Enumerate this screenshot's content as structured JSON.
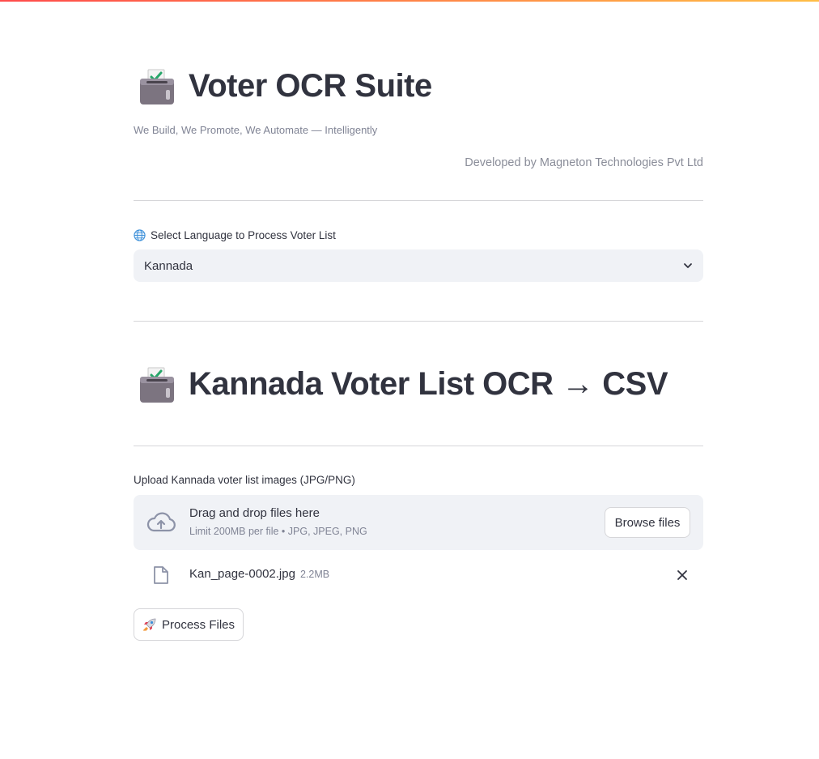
{
  "app": {
    "title": "Voter OCR Suite",
    "title_icon": "ballot-box-icon",
    "tagline": "We Build, We Promote, We Automate — Intelligently",
    "developed_by": "Developed by Magneton Technologies Pvt Ltd"
  },
  "language": {
    "label": "Select Language to Process Voter List",
    "label_icon": "globe-icon",
    "selected": "Kannada"
  },
  "section": {
    "title": "Kannada Voter List OCR → CSV",
    "title_icon": "ballot-box-icon"
  },
  "upload": {
    "label": "Upload Kannada voter list images (JPG/PNG)",
    "drop_title": "Drag and drop files here",
    "limit_text": "Limit 200MB per file • JPG, JPEG, PNG",
    "browse_label": "Browse files",
    "files": [
      {
        "name": "Kan_page-0002.jpg",
        "size": "2.2MB"
      }
    ]
  },
  "actions": {
    "process_label": "Process Files",
    "process_icon": "rocket-icon"
  },
  "colors": {
    "accent_gradient_start": "#ff4b4b",
    "accent_gradient_end": "#ffbd45",
    "text": "#31333f",
    "muted": "#808495",
    "input_bg": "#f0f2f6"
  }
}
